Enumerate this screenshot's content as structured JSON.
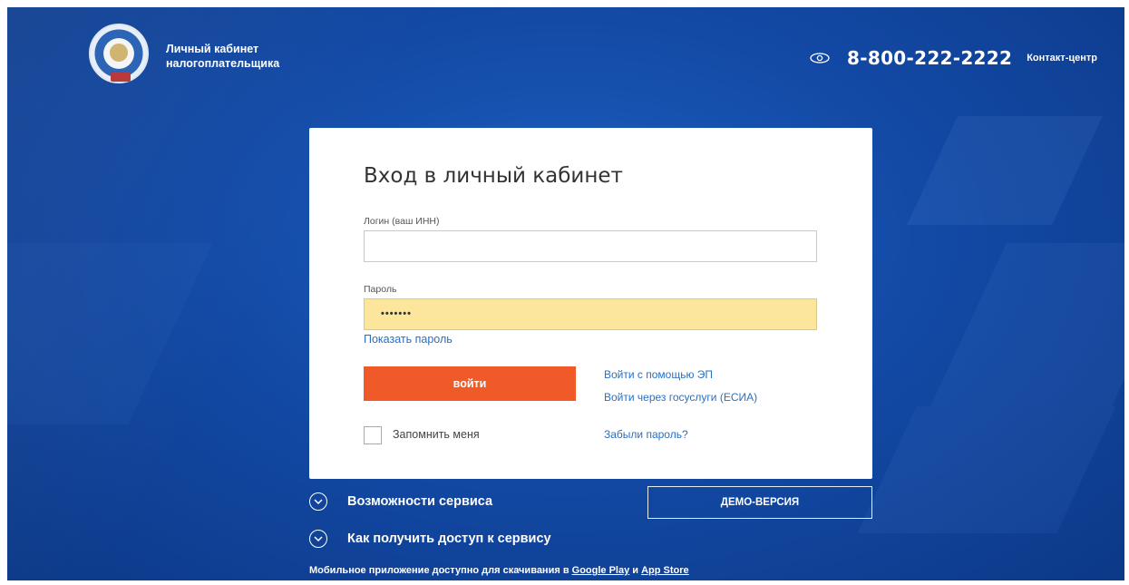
{
  "header": {
    "brand_line1": "Личный кабинет",
    "brand_line2": "налогоплательщика",
    "phone_icon": "eye-icon",
    "phone": "8-800-222-2222",
    "contact_label": "Контакт-центр"
  },
  "login": {
    "title": "Вход в личный кабинет",
    "login_label": "Логин (ваш ИНН)",
    "login_value": "",
    "password_label": "Пароль",
    "password_value": "•••••••",
    "show_password": "Показать пароль",
    "submit": "войти",
    "login_ep": "Войти с помощью ЭП",
    "login_gosuslugi": "Войти через госуслуги (ЕСИА)",
    "remember_me": "Запомнить меня",
    "forgot_password": "Забыли пароль?"
  },
  "below": {
    "features": "Возможности сервиса",
    "access": "Как получить доступ к сервису",
    "demo": "ДЕМО-ВЕРСИЯ",
    "mobile_text": "Мобильное приложение доступно для скачивания в",
    "google_play": "Google Play",
    "and": "и",
    "app_store": "App Store"
  },
  "colors": {
    "background": "#134aa6",
    "accent_button": "#f05a28",
    "password_fill": "#fbe69b",
    "link": "#2a6fc0"
  }
}
